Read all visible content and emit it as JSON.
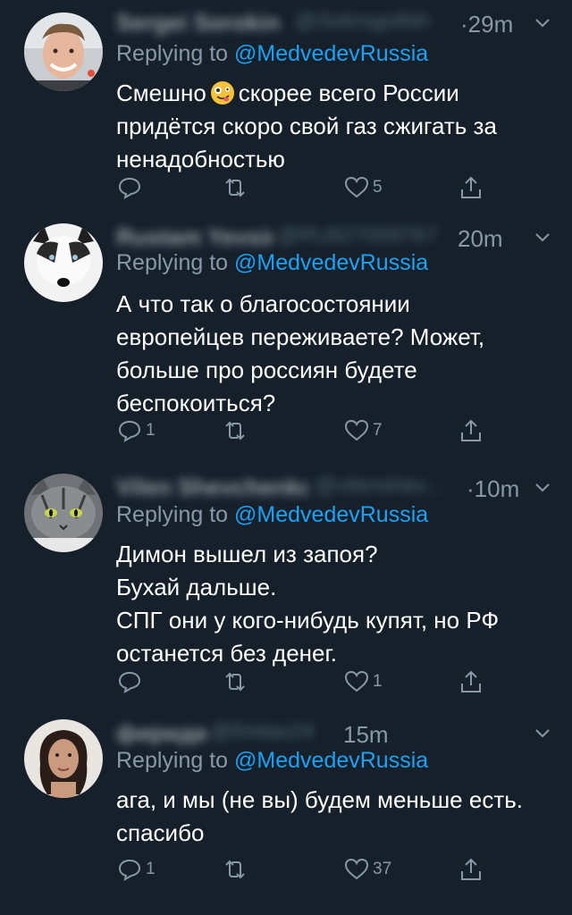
{
  "tweets": [
    {
      "author_name": "Sergei Sorokin",
      "author_handle": "@Sokrogolibh",
      "dot": "·",
      "time": "29m",
      "replying_prefix": "Replying to",
      "replying_mention": "@MedvedevRussia",
      "text_before_emoji": "Смешно",
      "emoji_name": "zany-face-emoji",
      "text_after_emoji": "скорее всего России придётся скоро свой газ сжигать за ненадобностью",
      "reply_count": "",
      "retweet_count": "",
      "like_count": "5"
    },
    {
      "author_name": "Rustam Yevsin",
      "author_handle": "@RU827009767",
      "dot": "",
      "time": "20m",
      "replying_prefix": "Replying to",
      "replying_mention": "@MedvedevRussia",
      "text": "А что так о благосостоянии европейцев переживаете? Может, больше про россиян будете беспокоиться?",
      "reply_count": "1",
      "retweet_count": "",
      "like_count": "7"
    },
    {
      "author_name": "Vilen Shevchenko",
      "author_handle": "@vilenshev...",
      "dot": "·",
      "time": "10m",
      "replying_prefix": "Replying to",
      "replying_mention": "@MedvedevRussia",
      "text_lines": [
        "Димон вышел из запоя?",
        "Бухай дальше.",
        "СПГ они у кого-нибудь купят, но РФ останется без денег."
      ],
      "reply_count": "",
      "retweet_count": "",
      "like_count": "1"
    },
    {
      "author_name": "фирида",
      "author_handle": "@firidao24",
      "dot": "",
      "time": "15m",
      "replying_prefix": "Replying to",
      "replying_mention": "@MedvedevRussia",
      "text": "ага, и мы (не вы) будем меньше есть. спасибо",
      "reply_count": "1",
      "retweet_count": "",
      "like_count": "37"
    }
  ],
  "colors": {
    "background": "#15202b",
    "secondary_text": "#8899a6",
    "mention": "#1da1f2",
    "text": "#ffffff"
  }
}
